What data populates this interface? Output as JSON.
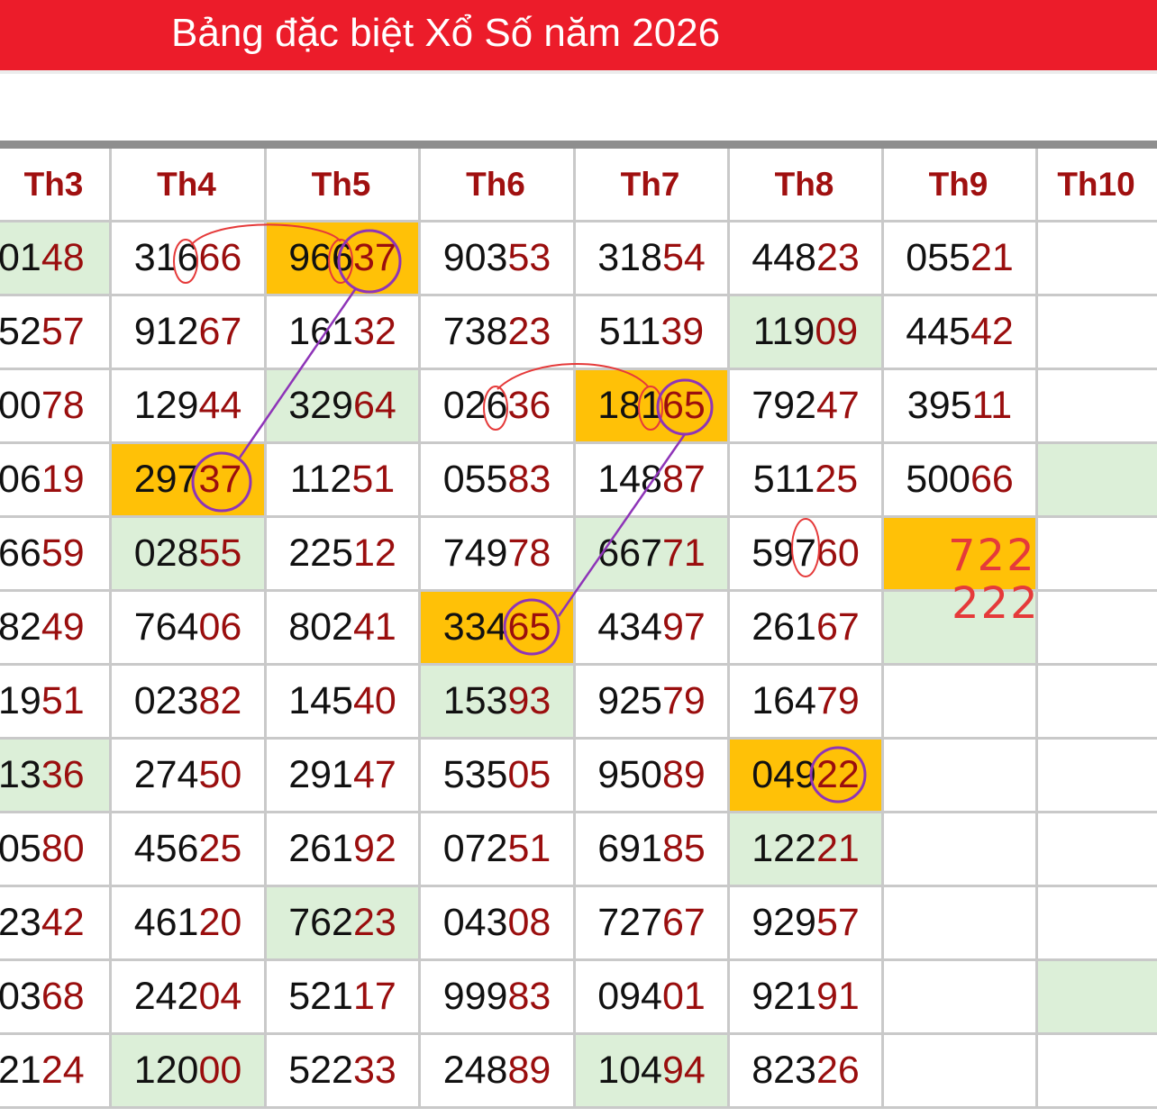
{
  "header": {
    "title": "Bảng đặc biệt Xổ Số năm 2026"
  },
  "colors": {
    "header_red": "#ec1c2a",
    "digit_dark": "#111111",
    "digit_red": "#9a0e0e",
    "heading_red": "#a01010",
    "highlight_green": "#dcefd8",
    "highlight_orange": "#ffc107",
    "annotation_red": "#e53a3a",
    "annotation_purple": "#8e34b8"
  },
  "table": {
    "columns": [
      "Th3",
      "Th4",
      "Th5",
      "Th6",
      "Th7",
      "Th8",
      "Th9",
      "Th10"
    ],
    "rows": [
      [
        {
          "v": "0148",
          "h": "green"
        },
        {
          "v": "31666"
        },
        {
          "v": "96637",
          "h": "orange"
        },
        {
          "v": "90353"
        },
        {
          "v": "31854"
        },
        {
          "v": "44823"
        },
        {
          "v": "05521"
        },
        {
          "v": ""
        }
      ],
      [
        {
          "v": "5257"
        },
        {
          "v": "91267"
        },
        {
          "v": "16132"
        },
        {
          "v": "73823"
        },
        {
          "v": "51139"
        },
        {
          "v": "11909",
          "h": "green"
        },
        {
          "v": "44542"
        },
        {
          "v": ""
        }
      ],
      [
        {
          "v": "0078"
        },
        {
          "v": "12944"
        },
        {
          "v": "32964",
          "h": "green"
        },
        {
          "v": "02636"
        },
        {
          "v": "18165",
          "h": "orange"
        },
        {
          "v": "79247"
        },
        {
          "v": "39511"
        },
        {
          "v": ""
        }
      ],
      [
        {
          "v": "0619"
        },
        {
          "v": "29737",
          "h": "orange"
        },
        {
          "v": "11251"
        },
        {
          "v": "05583"
        },
        {
          "v": "14887"
        },
        {
          "v": "51125"
        },
        {
          "v": "50066"
        },
        {
          "v": "",
          "h": "green"
        }
      ],
      [
        {
          "v": "6659"
        },
        {
          "v": "02855",
          "h": "green"
        },
        {
          "v": "22512"
        },
        {
          "v": "74978"
        },
        {
          "v": "66771",
          "h": "green"
        },
        {
          "v": "59760"
        },
        {
          "v": "",
          "h": "orange"
        },
        {
          "v": ""
        }
      ],
      [
        {
          "v": "8249"
        },
        {
          "v": "76406"
        },
        {
          "v": "80241"
        },
        {
          "v": "33465",
          "h": "orange"
        },
        {
          "v": "43497"
        },
        {
          "v": "26167"
        },
        {
          "v": "",
          "h": "green"
        },
        {
          "v": ""
        }
      ],
      [
        {
          "v": "1951"
        },
        {
          "v": "02382"
        },
        {
          "v": "14540"
        },
        {
          "v": "15393",
          "h": "green"
        },
        {
          "v": "92579"
        },
        {
          "v": "16479"
        },
        {
          "v": ""
        },
        {
          "v": ""
        }
      ],
      [
        {
          "v": "1336",
          "h": "green"
        },
        {
          "v": "27450"
        },
        {
          "v": "29147"
        },
        {
          "v": "53505"
        },
        {
          "v": "95089"
        },
        {
          "v": "04922",
          "h": "orange"
        },
        {
          "v": ""
        },
        {
          "v": ""
        }
      ],
      [
        {
          "v": "0580"
        },
        {
          "v": "45625"
        },
        {
          "v": "26192"
        },
        {
          "v": "07251"
        },
        {
          "v": "69185"
        },
        {
          "v": "12221",
          "h": "green"
        },
        {
          "v": ""
        },
        {
          "v": ""
        }
      ],
      [
        {
          "v": "2342"
        },
        {
          "v": "46120"
        },
        {
          "v": "76223",
          "h": "green"
        },
        {
          "v": "04308"
        },
        {
          "v": "72767"
        },
        {
          "v": "92957"
        },
        {
          "v": ""
        },
        {
          "v": ""
        }
      ],
      [
        {
          "v": "0368"
        },
        {
          "v": "24204"
        },
        {
          "v": "52117"
        },
        {
          "v": "99983"
        },
        {
          "v": "09401"
        },
        {
          "v": "92191"
        },
        {
          "v": ""
        },
        {
          "v": "",
          "h": "green"
        }
      ],
      [
        {
          "v": "2124"
        },
        {
          "v": "12000",
          "h": "green"
        },
        {
          "v": "52233"
        },
        {
          "v": "24889"
        },
        {
          "v": "10494",
          "h": "green"
        },
        {
          "v": "82326"
        },
        {
          "v": ""
        },
        {
          "v": ""
        }
      ]
    ]
  },
  "handwriting": {
    "line1": "722",
    "line2": "222"
  }
}
